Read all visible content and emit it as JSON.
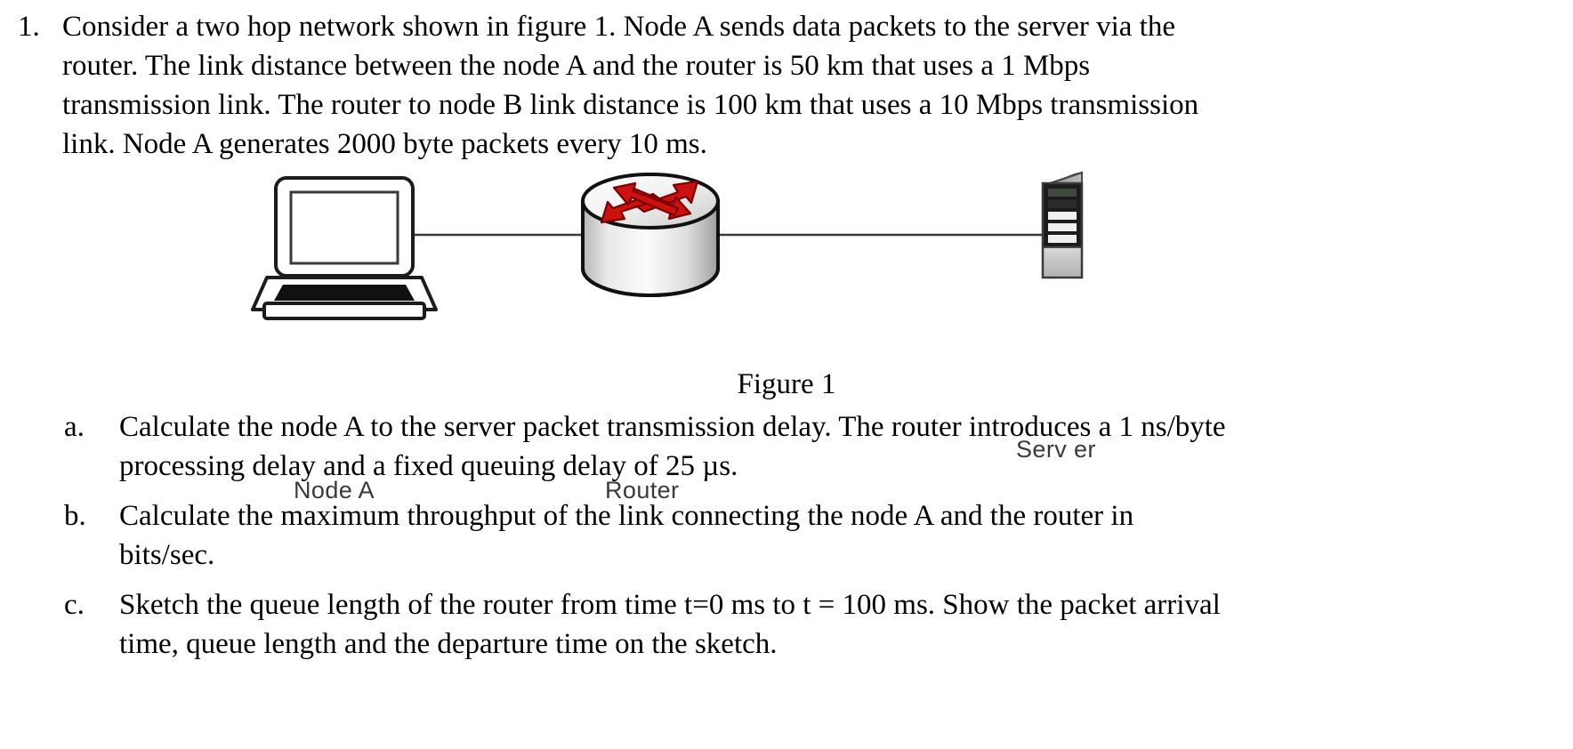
{
  "question": {
    "marker": "1.",
    "lines": [
      "Consider a two hop network shown in figure 1. Node A sends data packets to the server via the",
      "router. The link distance between the node A and the router is 50 km that uses a 1 Mbps",
      "transmission link. The router to node B link distance is 100 km that uses a 10 Mbps transmission",
      "link. Node A generates 2000 byte packets every 10 ms."
    ],
    "full_text": "Consider a two hop network shown in figure 1. Node A sends data packets to the server via the router. The link distance between the node A and the router is 50 km that uses a 1 Mbps transmission link. The router to node B link distance is 100 km that uses a 10 Mbps transmission link. Node A generates 2000 byte packets every 10 ms."
  },
  "figure": {
    "caption": "Figure 1",
    "nodes": [
      {
        "id": "node-a",
        "label": "Node A",
        "icon": "laptop-icon"
      },
      {
        "id": "router",
        "label": "Router",
        "icon": "router-icon"
      },
      {
        "id": "server",
        "label": "Serv er",
        "icon": "server-icon"
      }
    ],
    "links": [
      {
        "from": "node-a",
        "to": "router"
      },
      {
        "from": "router",
        "to": "server"
      }
    ],
    "colors": {
      "router_arrow": "#cc1111",
      "router_arrow_dark": "#8b0000",
      "line": "#3a3a3a",
      "label_text": "#3a3a3a",
      "server_body": "#9a9a9a",
      "server_panel": "#1c1c1c"
    }
  },
  "subitems": [
    {
      "marker": "a.",
      "lines": [
        "Calculate the node A to the server packet transmission delay. The router introduces a 1 ns/byte",
        "processing delay and a fixed queuing delay of 25 µs."
      ],
      "full_text": "Calculate the node A to the server packet transmission delay. The router introduces a 1 ns/byte processing delay and a fixed queuing delay of 25 µs."
    },
    {
      "marker": "b.",
      "lines": [
        "Calculate the maximum throughput of the link connecting the node A and the router in",
        "bits/sec."
      ],
      "full_text": "Calculate the maximum throughput of the link connecting the node A and the router in bits/sec."
    },
    {
      "marker": "c.",
      "lines": [
        "Sketch the queue length of the router from time t=0 ms to t = 100 ms. Show the packet arrival",
        "time, queue length and the departure time on the sketch."
      ],
      "full_text": "Sketch the queue length of the router from time t=0 ms to t = 100 ms. Show the packet arrival time, queue length and the departure time on the sketch."
    }
  ]
}
